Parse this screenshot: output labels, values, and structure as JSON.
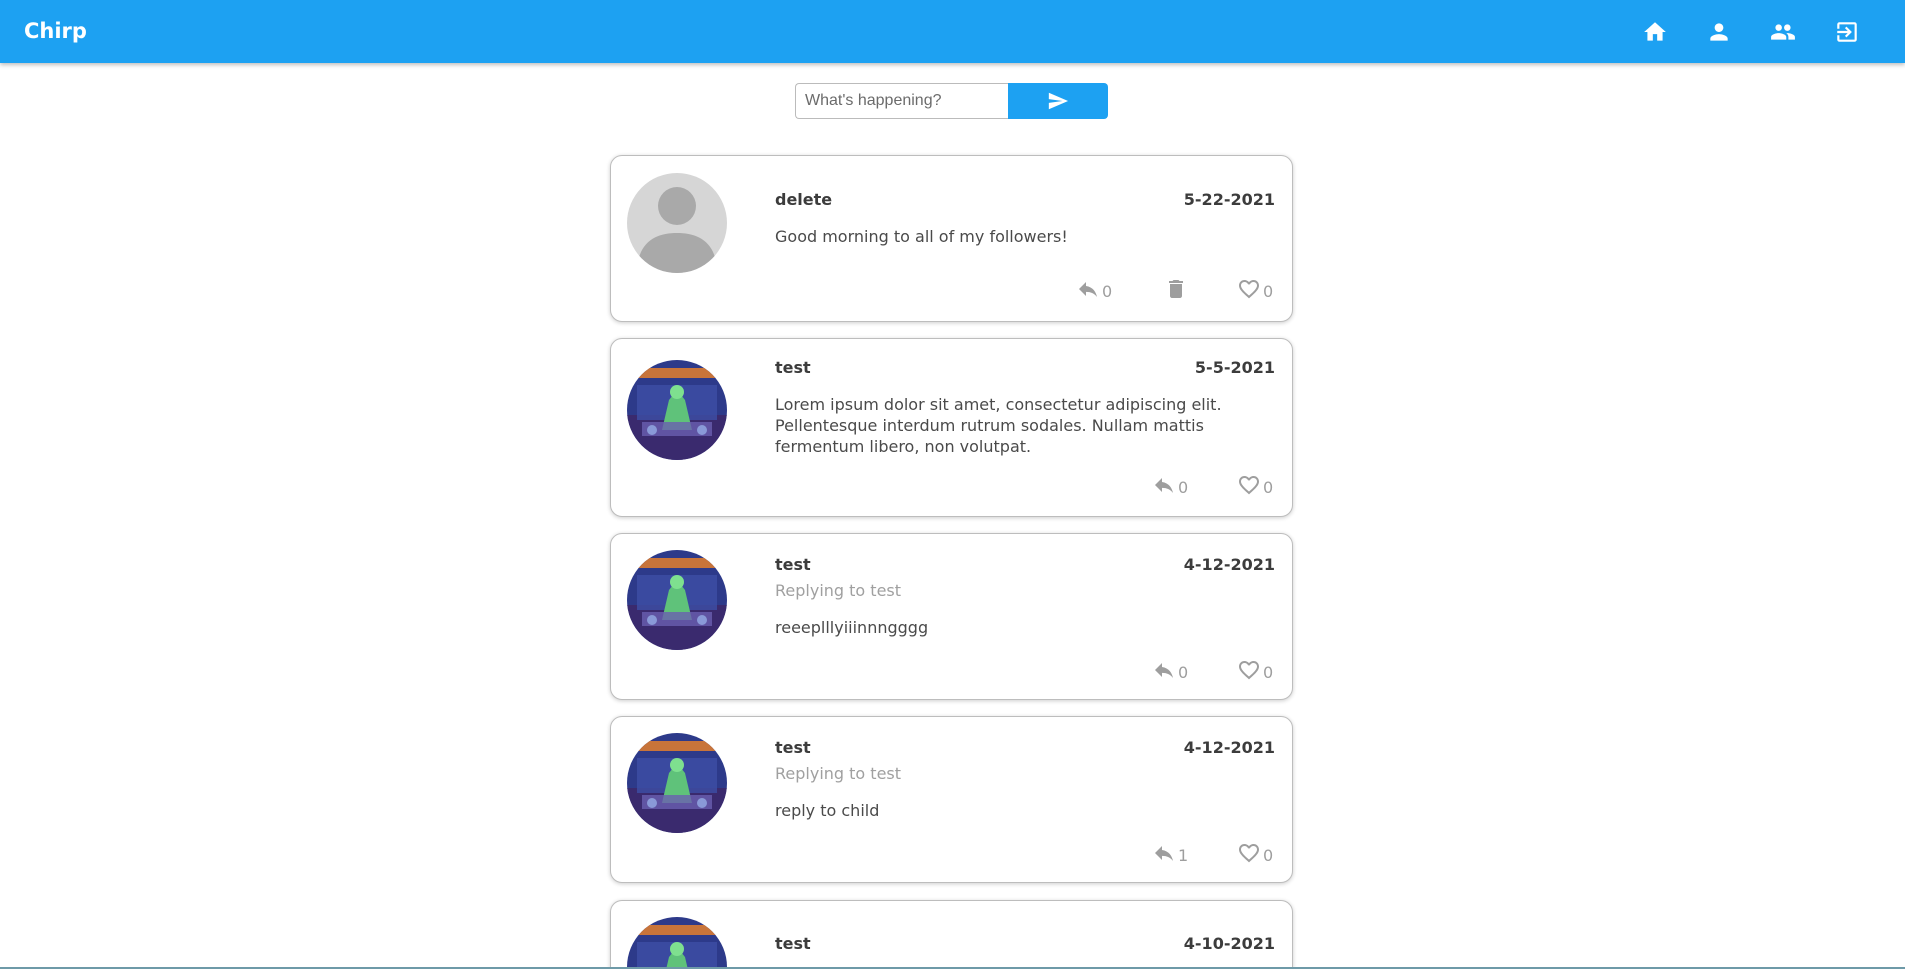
{
  "app": {
    "title": "Chirp"
  },
  "nav": {
    "home": "home-icon",
    "profile": "person-icon",
    "people": "people-icon",
    "logout": "logout-icon"
  },
  "compose": {
    "placeholder": "What's happening?",
    "send_icon": "send-icon"
  },
  "colors": {
    "brand": "#1da1f2",
    "muted": "#9e9e9e"
  },
  "posts": [
    {
      "username": "delete",
      "date": "5-22-2021",
      "text": "Good morning to all of my followers!",
      "replies": "0",
      "likes": "0",
      "avatar": "default-avatar",
      "deletable": true
    },
    {
      "username": "test",
      "date": "5-5-2021",
      "text": "Lorem ipsum dolor sit amet, consectetur adipiscing elit. Pellentesque interdum rutrum sodales. Nullam mattis fermentum libero, non volutpat.",
      "replies": "0",
      "likes": "0",
      "avatar": "megadeth-avatar"
    },
    {
      "username": "test",
      "date": "4-12-2021",
      "replying_to": "Replying to test",
      "text": "reeeplllyiiinnngggg",
      "replies": "0",
      "likes": "0",
      "avatar": "megadeth-avatar"
    },
    {
      "username": "test",
      "date": "4-12-2021",
      "replying_to": "Replying to test",
      "text": "reply to child",
      "replies": "1",
      "likes": "0",
      "avatar": "megadeth-avatar"
    },
    {
      "username": "test",
      "date": "4-10-2021",
      "avatar": "megadeth-avatar"
    }
  ]
}
